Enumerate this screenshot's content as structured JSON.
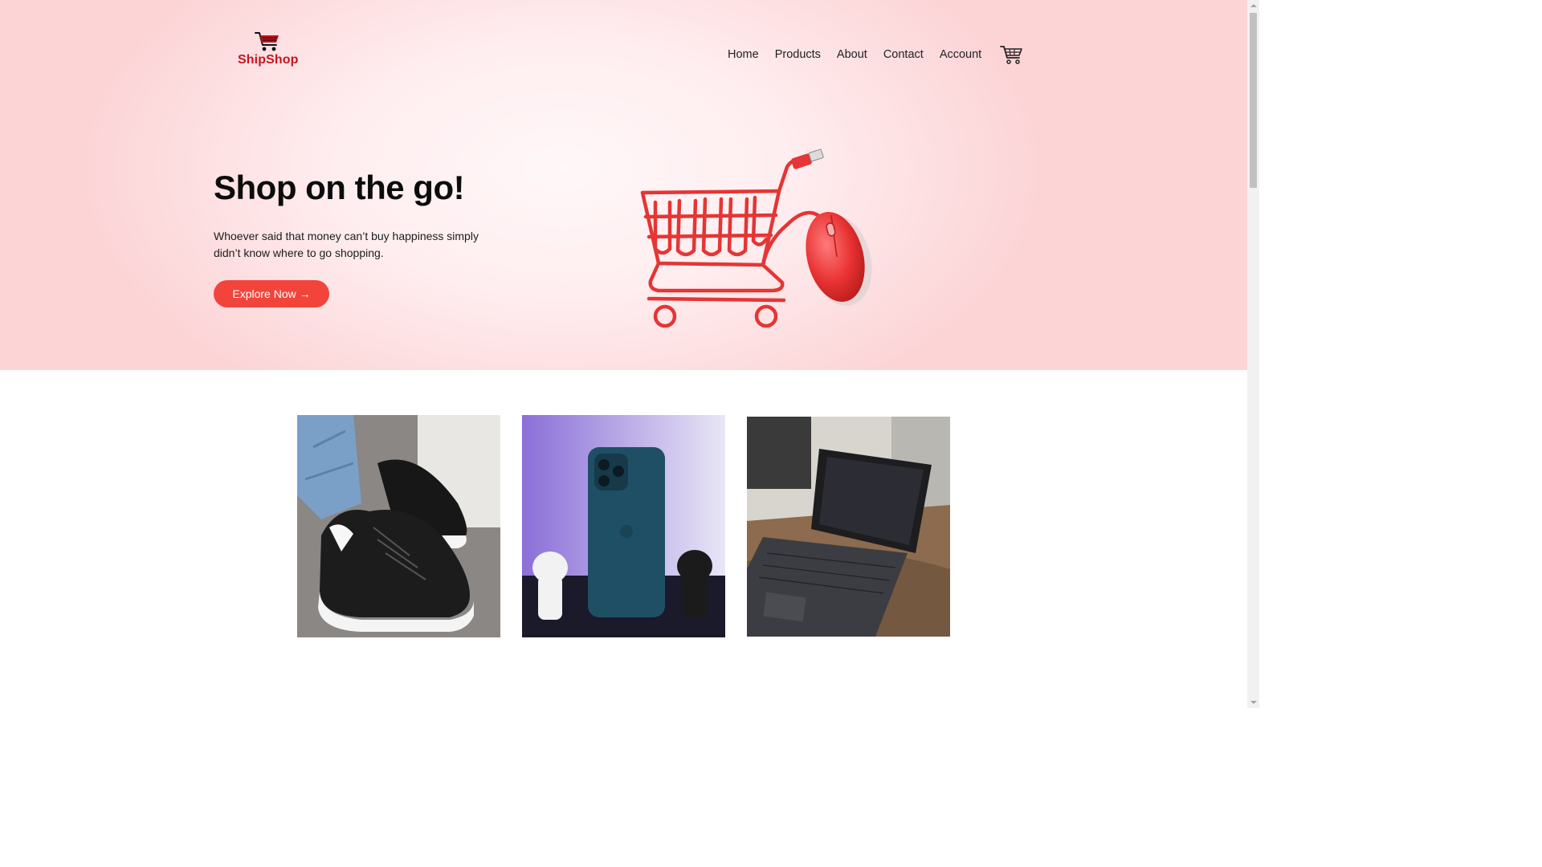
{
  "brand": {
    "name": "ShipShop",
    "logo_icon": "shopping-cart-icon",
    "color": "#c8141e"
  },
  "nav": {
    "items": [
      {
        "label": "Home"
      },
      {
        "label": "Products"
      },
      {
        "label": "About"
      },
      {
        "label": "Contact"
      },
      {
        "label": "Account"
      }
    ],
    "cart_icon": "shopping-cart-icon"
  },
  "hero": {
    "title": "Shop on the go!",
    "subtitle": "Whoever said that money can’t buy happiness simply didn’t know where to go shopping.",
    "cta_label": "Explore Now →",
    "cta_color": "#f2443b",
    "image": "shopping-cart-with-computer-mouse"
  },
  "products": [
    {
      "image": "black-sneakers"
    },
    {
      "image": "blue-phone-with-cat-figures"
    },
    {
      "image": "laptop-tablet-on-desk"
    }
  ]
}
